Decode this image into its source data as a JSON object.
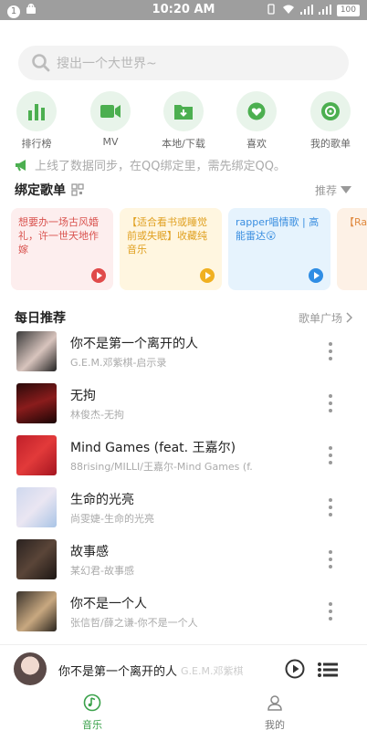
{
  "status": {
    "notification_count": "1",
    "time": "10:20 AM",
    "battery": "100"
  },
  "search": {
    "placeholder": "搜出一个大世界~"
  },
  "quick": [
    {
      "label": "排行榜",
      "icon": "bar-chart-icon"
    },
    {
      "label": "MV",
      "icon": "video-icon"
    },
    {
      "label": "本地/下载",
      "icon": "download-folder-icon"
    },
    {
      "label": "喜欢",
      "icon": "heart-icon"
    },
    {
      "label": "我的歌单",
      "icon": "music-disc-icon"
    }
  ],
  "notice": {
    "text": "上线了数据同步，在QQ绑定里，需先绑定QQ。"
  },
  "bound": {
    "title": "绑定歌单",
    "sort_label": "推荐"
  },
  "cards": [
    {
      "text": "想要办一场古风婚礼，许一世天地作嫁",
      "bg": "#fdeeee",
      "color": "#d9534f",
      "play": "#e04a4a"
    },
    {
      "text": "【适合看书或睡觉前或失眠】收藏纯音乐",
      "bg": "#fff6e0",
      "color": "#e0a020",
      "play": "#f0b020"
    },
    {
      "text": "rapper唱情歌 | 高能雷达😲",
      "bg": "#e6f3fd",
      "color": "#3a8ee0",
      "play": "#2f8de4"
    },
    {
      "text": "【Ra觉丰",
      "bg": "#fdf1e6",
      "color": "#e08a40",
      "play": "#e08a40"
    }
  ],
  "daily": {
    "title": "每日推荐",
    "more": "歌单广场"
  },
  "songs": [
    {
      "title": "你不是第一个离开的人",
      "subtitle": "G.E.M.邓紫棋-启示录",
      "cover": "linear-gradient(135deg,#3a3a3a,#d8c4bd 55%,#222)"
    },
    {
      "title": "无拘",
      "subtitle": "林俊杰-无拘",
      "cover": "linear-gradient(160deg,#2a0a0a,#8a1c1c 50%,#1a0505)"
    },
    {
      "title": "Mind Games (feat. 王嘉尔)",
      "subtitle": "88rising/MILLI/王嘉尔-Mind Games (f...",
      "cover": "linear-gradient(135deg,#c0202a,#e23a3a 50%,#a51520)"
    },
    {
      "title": "生命的光亮",
      "subtitle": "尚雯婕-生命的光亮",
      "cover": "linear-gradient(135deg,#cfd8ee,#eae6f2 50%,#a9c4e6)"
    },
    {
      "title": "故事感",
      "subtitle": "某幻君-故事感",
      "cover": "linear-gradient(135deg,#2a2220,#5a4538 50%,#1c1614)"
    },
    {
      "title": "你不是一个人",
      "subtitle": "张信哲/薛之谦-你不是一个人",
      "cover": "linear-gradient(135deg,#3a332c,#c8a880 55%,#2a241e)"
    }
  ],
  "player": {
    "title": "你不是第一个离开的人",
    "artist": "G.E.M.邓紫棋"
  },
  "tabs": [
    {
      "label": "音乐",
      "active": true
    },
    {
      "label": "我的",
      "active": false
    }
  ],
  "colors": {
    "accent": "#3aa14a",
    "icon_green": "#4caf50"
  }
}
